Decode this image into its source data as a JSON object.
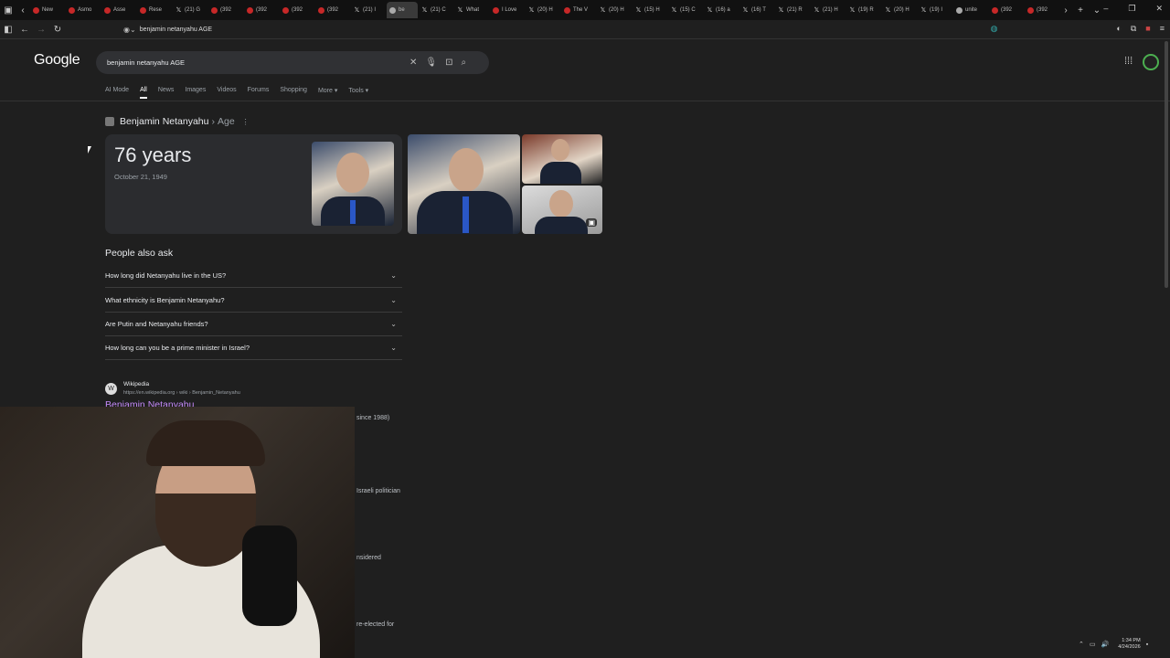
{
  "browser": {
    "tabs": [
      {
        "label": "New",
        "icon": "red-dot-icon"
      },
      {
        "label": "Asmo",
        "icon": "red-dot-icon"
      },
      {
        "label": "Asse",
        "icon": "red-dot-icon"
      },
      {
        "label": "Rese",
        "icon": "red-dot-icon"
      },
      {
        "label": "(21) G",
        "icon": "x-icon"
      },
      {
        "label": "(392",
        "icon": "red-dot-icon"
      },
      {
        "label": "(392",
        "icon": "red-dot-icon"
      },
      {
        "label": "(392",
        "icon": "red-dot-icon"
      },
      {
        "label": "(392",
        "icon": "red-dot-icon"
      },
      {
        "label": "(21) I",
        "icon": "x-icon"
      },
      {
        "label": "be",
        "icon": "globe-icon",
        "active": true
      },
      {
        "label": "(21) C",
        "icon": "x-icon"
      },
      {
        "label": "What",
        "icon": "x-icon"
      },
      {
        "label": "I Love",
        "icon": "red-dot-icon"
      },
      {
        "label": "(20) H",
        "icon": "x-icon"
      },
      {
        "label": "The V",
        "icon": "red-dot-icon"
      },
      {
        "label": "(20) H",
        "icon": "x-icon"
      },
      {
        "label": "(15) H",
        "icon": "x-icon"
      },
      {
        "label": "(15) C",
        "icon": "x-icon"
      },
      {
        "label": "(16) a",
        "icon": "x-icon"
      },
      {
        "label": "(16) T",
        "icon": "x-icon"
      },
      {
        "label": "(21) R",
        "icon": "x-icon"
      },
      {
        "label": "(21) H",
        "icon": "x-icon"
      },
      {
        "label": "(19) R",
        "icon": "x-icon"
      },
      {
        "label": "(20) H",
        "icon": "x-icon"
      },
      {
        "label": "(19) I",
        "icon": "x-icon"
      },
      {
        "label": "unite",
        "icon": "globe-icon"
      },
      {
        "label": "(392",
        "icon": "red-dot-icon"
      },
      {
        "label": "(392",
        "icon": "red-dot-icon"
      }
    ],
    "address": "benjamin netanyahu AGE"
  },
  "google": {
    "logo": "Google",
    "query": "benjamin netanyahu AGE",
    "filters": [
      "AI Mode",
      "All",
      "News",
      "Images",
      "Videos",
      "Forums",
      "Shopping",
      "More ▾",
      "Tools ▾"
    ],
    "active_filter": "All"
  },
  "knowledge": {
    "entity": "Benjamin Netanyahu",
    "separator": "›",
    "attribute": "Age",
    "age": "76 years",
    "birth_date": "October 21, 1949"
  },
  "people_also_ask": {
    "title": "People also ask",
    "questions": [
      "How long did Netanyahu live in the US?",
      "What ethnicity is Benjamin Netanyahu?",
      "Are Putin and Netanyahu friends?",
      "How long can you be a prime minister in Israel?"
    ]
  },
  "result": {
    "site": "Wikipedia",
    "url": "https://en.wikipedia.org › wiki › Benjamin_Netanyahu",
    "title": "Benjamin Netanyahu",
    "fragments": [
      "since 1988)",
      "Israeli politician",
      "nsidered",
      "re-elected for"
    ]
  },
  "taskbar": {
    "time": "1:34 PM",
    "date": "4/24/2026"
  },
  "colors": {
    "background": "#1f1f1f",
    "link_visited": "#c58af9",
    "muted_text": "#9aa0a6"
  }
}
